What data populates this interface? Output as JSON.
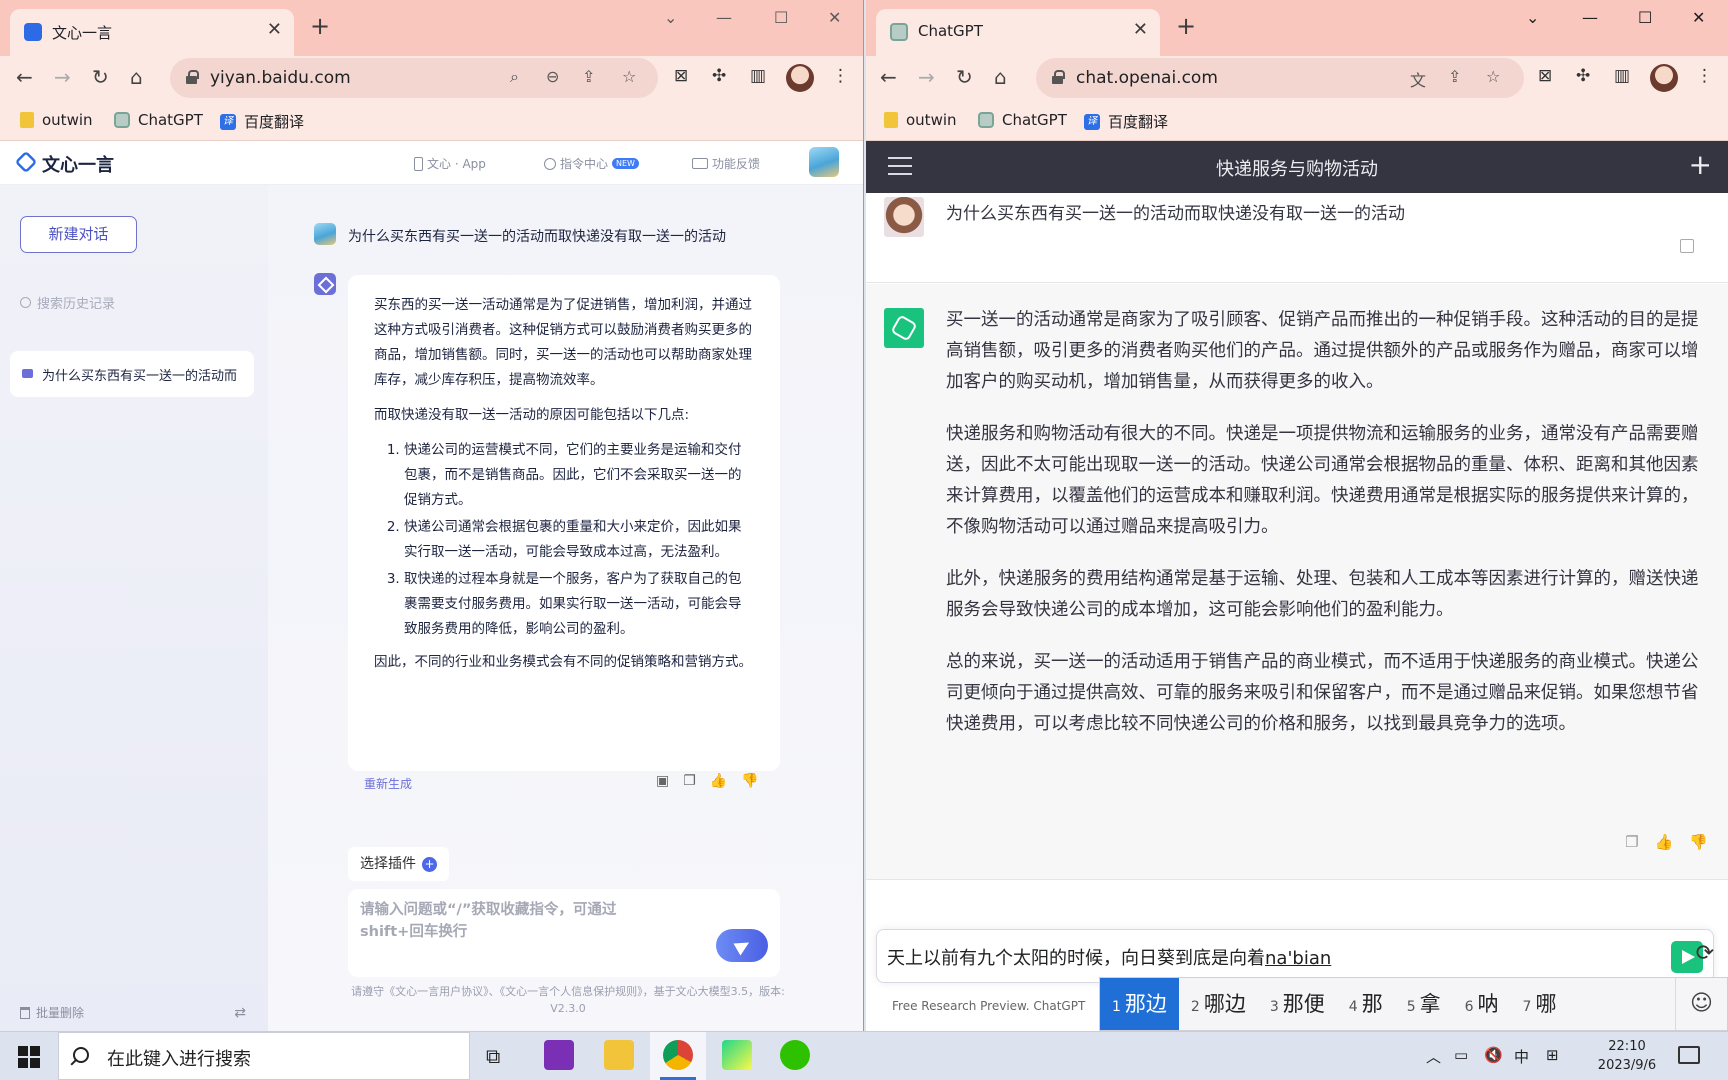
{
  "left_window": {
    "tab": {
      "title": "文心一言"
    },
    "url": "yiyan.baidu.com",
    "bookmarks": [
      {
        "label": "outwin",
        "icon": "folder-icon"
      },
      {
        "label": "ChatGPT",
        "icon": "chatgpt-icon"
      },
      {
        "label": "百度翻译",
        "icon": "baidu-translate-icon"
      }
    ],
    "app": {
      "logo": "文心一言",
      "header_links": {
        "app": "文心 · App",
        "commands": "指令中心",
        "commands_badge": "NEW",
        "feedback": "功能反馈"
      },
      "sidebar": {
        "new_chat": "新建对话",
        "search_placeholder": "搜索历史记录",
        "history": [
          "为什么买东西有买一送一的活动而"
        ],
        "batch_delete": "批量删除"
      },
      "question": "为什么买东西有买一送一的活动而取快递没有取一送一的活动",
      "answer": {
        "p1": "买东西的买一送一活动通常是为了促进销售，增加利润，并通过这种方式吸引消费者。这种促销方式可以鼓励消费者购买更多的商品，增加销售额。同时，买一送一的活动也可以帮助商家处理库存，减少库存积压，提高物流效率。",
        "p2": "而取快递没有取一送一活动的原因可能包括以下几点:",
        "items": [
          "快递公司的运营模式不同，它们的主要业务是运输和交付包裹，而不是销售商品。因此，它们不会采取买一送一的促销方式。",
          "快递公司通常会根据包裹的重量和大小来定价，因此如果实行取一送一活动，可能会导致成本过高，无法盈利。",
          "取快递的过程本身就是一个服务，客户为了获取自己的包裹需要支付服务费用。如果实行取一送一活动，可能会导致服务费用的降低，影响公司的盈利。"
        ],
        "p3": "因此，不同的行业和业务模式会有不同的促销策略和营销方式。"
      },
      "regenerate": "重新生成",
      "plugin_button": "选择插件",
      "input_placeholder": "请输入问题或“/”获取收藏指令，可通过shift+回车换行",
      "footer": "请遵守《文心一言用户协议》、《文心一言个人信息保护规则》，基于文心大模型3.5，版本: V2.3.0"
    }
  },
  "right_window": {
    "tab": {
      "title": "ChatGPT"
    },
    "url": "chat.openai.com",
    "bookmarks": [
      {
        "label": "outwin",
        "icon": "folder-icon"
      },
      {
        "label": "ChatGPT",
        "icon": "chatgpt-icon"
      },
      {
        "label": "百度翻译",
        "icon": "baidu-translate-icon"
      }
    ],
    "app": {
      "title": "快递服务与购物活动",
      "question": "为什么买东西有买一送一的活动而取快递没有取一送一的活动",
      "answer": [
        "买一送一的活动通常是商家为了吸引顾客、促销产品而推出的一种促销手段。这种活动的目的是提高销售额，吸引更多的消费者购买他们的产品。通过提供额外的产品或服务作为赠品，商家可以增加客户的购买动机，增加销售量，从而获得更多的收入。",
        "快递服务和购物活动有很大的不同。快递是一项提供物流和运输服务的业务，通常没有产品需要赠送，因此不太可能出现取一送一的活动。快递公司通常会根据物品的重量、体积、距离和其他因素来计算费用，以覆盖他们的运营成本和赚取利润。快递费用通常是根据实际的服务提供来计算的，不像购物活动可以通过赠品来提高吸引力。",
        "此外，快递服务的费用结构通常是基于运输、处理、包装和人工成本等因素进行计算的，赠送快递服务会导致快递公司的成本增加，这可能会影响他们的盈利能力。",
        "总的来说，买一送一的活动适用于销售产品的商业模式，而不适用于快递服务的商业模式。快递公司更倾向于通过提供高效、可靠的服务来吸引和保留客户，而不是通过赠品来促销。如果您想节省快递费用，可以考虑比较不同快递公司的价格和服务，以找到最具竞争力的选项。"
      ],
      "input_text": "天上以前有九个太阳的时候，向日葵到底是向着",
      "input_composition": "na'bian",
      "footer": "Free Research Preview. ChatGPT"
    }
  },
  "ime": {
    "candidates": [
      {
        "num": "1",
        "text": "那边"
      },
      {
        "num": "2",
        "text": "哪边"
      },
      {
        "num": "3",
        "text": "那便"
      },
      {
        "num": "4",
        "text": "那"
      },
      {
        "num": "5",
        "text": "拿"
      },
      {
        "num": "6",
        "text": "呐"
      },
      {
        "num": "7",
        "text": "哪"
      }
    ]
  },
  "taskbar": {
    "search_placeholder": "在此键入进行搜索",
    "ime_indicator": "中",
    "time": "22:10",
    "date": "2023/9/6"
  },
  "colors": {
    "chrome_frame": "#f9c7bd",
    "chatgpt_green": "#19c37d",
    "wenxin_accent": "#4b53c4",
    "ime_selected": "#1f6fd6"
  }
}
